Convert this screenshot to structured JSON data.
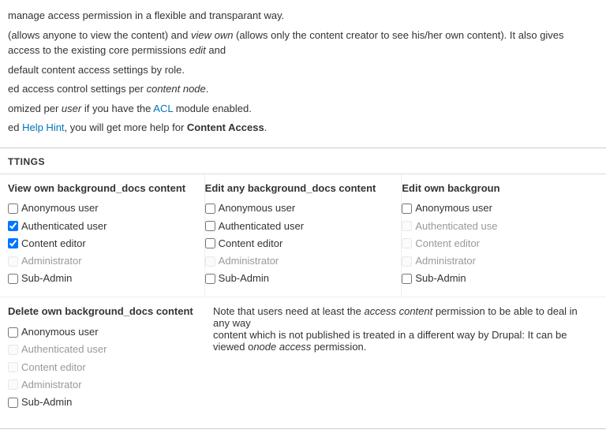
{
  "intro": {
    "line1": "manage access permission in a flexible and transparant way.",
    "line2_before": "(allows anyone to view the content) and ",
    "line2_italic1": "view own",
    "line2_after1": " (allows only the content creator to see his/her own content). It also gives access to the existing core permissions ",
    "line2_italic2": "edit",
    "line2_after2": " and",
    "line3": "default content access settings by role.",
    "line4": "ed access control settings per ",
    "line4_italic": "content node",
    "line4_after": ".",
    "line5_before": "omized per ",
    "line5_italic": "user",
    "line5_after": " if you have the ",
    "line5_link": "ACL",
    "line5_after2": " module enabled.",
    "line6_before": "ed ",
    "line6_link": "Help Hint",
    "line6_after1": ", you will get more help for ",
    "line6_strong": "Content Access",
    "line6_after2": "."
  },
  "settings_title": "TTINGS",
  "columns": {
    "col1": {
      "title": "View own background_docs content",
      "items": [
        {
          "label": "Anonymous user",
          "checked": false,
          "disabled": false
        },
        {
          "label": "Authenticated user",
          "checked": true,
          "disabled": false
        },
        {
          "label": "Content editor",
          "checked": true,
          "disabled": false
        },
        {
          "label": "Administrator",
          "checked": false,
          "disabled": true
        },
        {
          "label": "Sub-Admin",
          "checked": false,
          "disabled": false
        }
      ]
    },
    "col2": {
      "title": "Edit any background_docs content",
      "items": [
        {
          "label": "Anonymous user",
          "checked": false,
          "disabled": false
        },
        {
          "label": "Authenticated user",
          "checked": false,
          "disabled": false
        },
        {
          "label": "Content editor",
          "checked": false,
          "disabled": false
        },
        {
          "label": "Administrator",
          "checked": false,
          "disabled": true
        },
        {
          "label": "Sub-Admin",
          "checked": false,
          "disabled": false
        }
      ]
    },
    "col3": {
      "title": "Edit own backgroun",
      "items": [
        {
          "label": "Anonymous user",
          "checked": false,
          "disabled": false
        },
        {
          "label": "Authenticated use",
          "checked": false,
          "disabled": true
        },
        {
          "label": "Content editor",
          "checked": false,
          "disabled": true
        },
        {
          "label": "Administrator",
          "checked": false,
          "disabled": true
        },
        {
          "label": "Sub-Admin",
          "checked": false,
          "disabled": false
        }
      ]
    }
  },
  "delete_section": {
    "title": "Delete own background_docs content",
    "items": [
      {
        "label": "Anonymous user",
        "checked": false,
        "disabled": false
      },
      {
        "label": "Authenticated user",
        "checked": false,
        "disabled": true
      },
      {
        "label": "Content editor",
        "checked": false,
        "disabled": true
      },
      {
        "label": "Administrator",
        "checked": false,
        "disabled": true
      },
      {
        "label": "Sub-Admin",
        "checked": false,
        "disabled": false
      }
    ]
  },
  "note": {
    "text1": "Note that users need at least the ",
    "italic1": "access content",
    "text2": " permission to be able to deal in any way",
    "text3": "content which is not published is treated in a different way by Drupal: It can be viewed o",
    "italic2": "node access",
    "text4": " permission."
  }
}
